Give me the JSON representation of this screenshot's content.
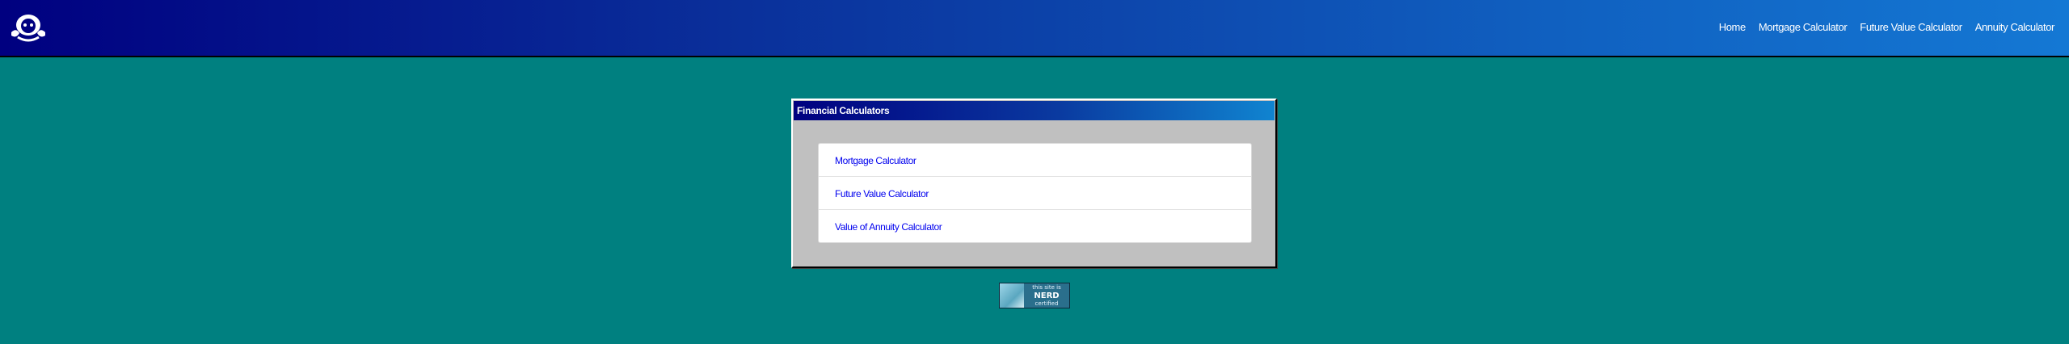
{
  "nav": {
    "logo_icon": "mascot-logo-icon",
    "links": [
      {
        "label": "Home"
      },
      {
        "label": "Mortgage Calculator"
      },
      {
        "label": "Future Value Calculator"
      },
      {
        "label": "Annuity Calculator"
      }
    ]
  },
  "window": {
    "title": "Financial Calculators",
    "items": [
      {
        "label": "Mortgage Calculator"
      },
      {
        "label": "Future Value Calculator"
      },
      {
        "label": "Value of Annuity Calculator"
      }
    ]
  },
  "badge": {
    "line1": "this site is",
    "line2": "NERD",
    "line3": "certified"
  },
  "colors": {
    "background": "#008080",
    "window": "#c0c0c0",
    "link": "#0000ee",
    "titlebar_start": "#000080",
    "titlebar_end": "#1084d0"
  }
}
